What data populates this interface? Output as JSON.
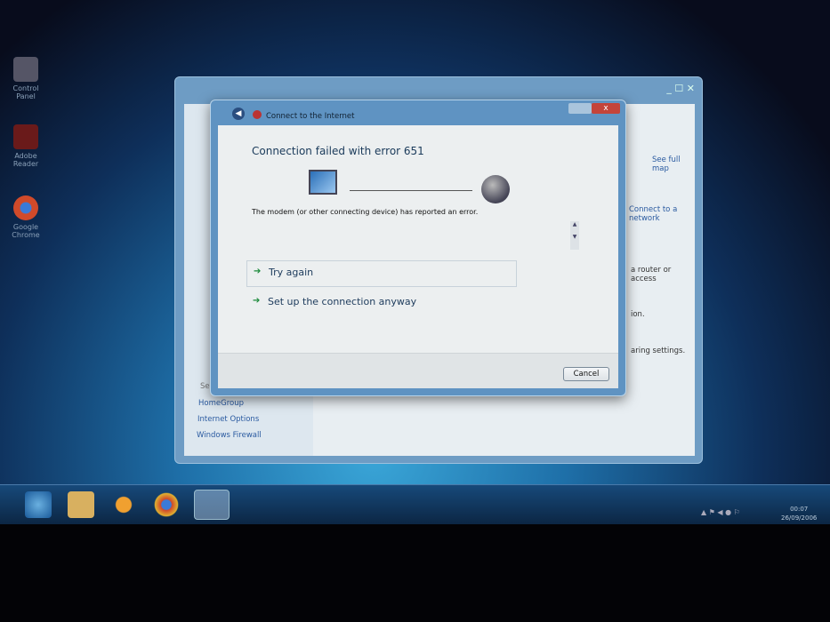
{
  "desktop": {
    "icons": [
      {
        "label": "Control Panel"
      },
      {
        "label": "Adobe Reader"
      },
      {
        "label": "Google Chrome"
      }
    ]
  },
  "background_window": {
    "right_links": [
      "See full map",
      "Connect to a network",
      "a router or access",
      "ion.",
      "aring settings."
    ],
    "see_also": "See also",
    "sidebar_links": [
      "HomeGroup",
      "Internet Options",
      "Windows Firewall"
    ]
  },
  "dialog": {
    "title": "Connect to the Internet",
    "heading": "Connection failed with error 651",
    "message": "The modem (or other connecting device) has reported an error.",
    "options": [
      "Try again",
      "Set up the connection anyway"
    ],
    "cancel": "Cancel",
    "close": "x"
  },
  "taskbar": {
    "time": "00:07",
    "date": "26/09/2006"
  }
}
